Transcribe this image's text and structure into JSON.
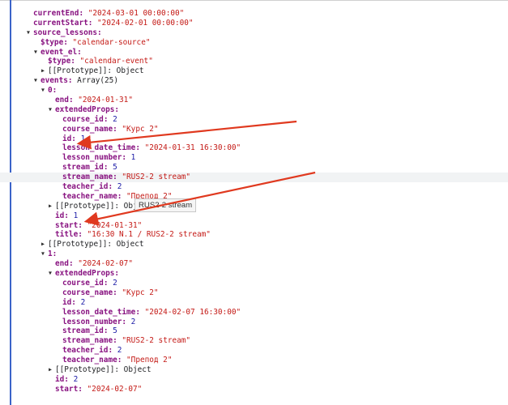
{
  "rows": [
    {
      "indent": 0,
      "key": "currentEnd",
      "sep": ": ",
      "value": "\"2024-03-01 00:00:00\"",
      "vtype": "s",
      "tri": ""
    },
    {
      "indent": 0,
      "key": "currentStart",
      "sep": ": ",
      "value": "\"2024-02-01 00:00:00\"",
      "vtype": "s",
      "tri": ""
    },
    {
      "indent": 0,
      "key": "source_lessons",
      "sep": ":",
      "value": "",
      "vtype": "s",
      "tri": "down"
    },
    {
      "indent": 1,
      "key": "$type",
      "sep": ": ",
      "value": "\"calendar-source\"",
      "vtype": "s",
      "tri": ""
    },
    {
      "indent": 1,
      "key": "event_el",
      "sep": ":",
      "value": "",
      "vtype": "s",
      "tri": "down"
    },
    {
      "indent": 2,
      "key": "$type",
      "sep": ": ",
      "value": "\"calendar-event\"",
      "vtype": "s",
      "tri": ""
    },
    {
      "indent": 2,
      "key": "[[Prototype]]",
      "sep": ": ",
      "value": "Object",
      "vtype": "p",
      "tri": "right",
      "keyPlain": true
    },
    {
      "indent": 1,
      "key": "events",
      "sep": ": ",
      "value": "Array(25)",
      "vtype": "p",
      "tri": "down"
    },
    {
      "indent": 2,
      "key": "0",
      "sep": ":",
      "value": "",
      "vtype": "s",
      "tri": "down"
    },
    {
      "indent": 3,
      "key": "end",
      "sep": ": ",
      "value": "\"2024-01-31\"",
      "vtype": "s",
      "tri": ""
    },
    {
      "indent": 3,
      "key": "extendedProps",
      "sep": ":",
      "value": "",
      "vtype": "s",
      "tri": "down"
    },
    {
      "indent": 4,
      "key": "course_id",
      "sep": ": ",
      "value": "2",
      "vtype": "n",
      "tri": ""
    },
    {
      "indent": 4,
      "key": "course_name",
      "sep": ": ",
      "value": "\"Курс 2\"",
      "vtype": "s",
      "tri": ""
    },
    {
      "indent": 4,
      "key": "id",
      "sep": ": ",
      "value": "1",
      "vtype": "n",
      "tri": ""
    },
    {
      "indent": 4,
      "key": "lesson_date_time",
      "sep": ": ",
      "value": "\"2024-01-31 16:30:00\"",
      "vtype": "s",
      "tri": ""
    },
    {
      "indent": 4,
      "key": "lesson_number",
      "sep": ": ",
      "value": "1",
      "vtype": "n",
      "tri": ""
    },
    {
      "indent": 4,
      "key": "stream_id",
      "sep": ": ",
      "value": "5",
      "vtype": "n",
      "tri": ""
    },
    {
      "indent": 4,
      "key": "stream_name",
      "sep": ": ",
      "value": "\"RUS2-2 stream\"",
      "vtype": "s",
      "tri": "",
      "hl": true
    },
    {
      "indent": 4,
      "key": "teacher_id",
      "sep": ": ",
      "value": "2",
      "vtype": "n",
      "tri": ""
    },
    {
      "indent": 4,
      "key": "teacher_name",
      "sep": ": ",
      "value": "\"Препод 2\"",
      "vtype": "s",
      "tri": ""
    },
    {
      "indent": 3,
      "key": "[[Prototype]]",
      "sep": ": ",
      "value": "Object",
      "vtype": "p",
      "tri": "right",
      "keyPlain": true
    },
    {
      "indent": 3,
      "key": "id",
      "sep": ": ",
      "value": "1",
      "vtype": "n",
      "tri": ""
    },
    {
      "indent": 3,
      "key": "start",
      "sep": ": ",
      "value": "\"2024-01-31\"",
      "vtype": "s",
      "tri": ""
    },
    {
      "indent": 3,
      "key": "title",
      "sep": ": ",
      "value": "\"16:30 N.1 / RUS2-2 stream\"",
      "vtype": "s",
      "tri": ""
    },
    {
      "indent": 2,
      "key": "[[Prototype]]",
      "sep": ": ",
      "value": "Object",
      "vtype": "p",
      "tri": "right",
      "keyPlain": true
    },
    {
      "indent": 2,
      "key": "1",
      "sep": ":",
      "value": "",
      "vtype": "s",
      "tri": "down"
    },
    {
      "indent": 3,
      "key": "end",
      "sep": ": ",
      "value": "\"2024-02-07\"",
      "vtype": "s",
      "tri": ""
    },
    {
      "indent": 3,
      "key": "extendedProps",
      "sep": ":",
      "value": "",
      "vtype": "s",
      "tri": "down"
    },
    {
      "indent": 4,
      "key": "course_id",
      "sep": ": ",
      "value": "2",
      "vtype": "n",
      "tri": ""
    },
    {
      "indent": 4,
      "key": "course_name",
      "sep": ": ",
      "value": "\"Курс 2\"",
      "vtype": "s",
      "tri": ""
    },
    {
      "indent": 4,
      "key": "id",
      "sep": ": ",
      "value": "2",
      "vtype": "n",
      "tri": ""
    },
    {
      "indent": 4,
      "key": "lesson_date_time",
      "sep": ": ",
      "value": "\"2024-02-07 16:30:00\"",
      "vtype": "s",
      "tri": ""
    },
    {
      "indent": 4,
      "key": "lesson_number",
      "sep": ": ",
      "value": "2",
      "vtype": "n",
      "tri": ""
    },
    {
      "indent": 4,
      "key": "stream_id",
      "sep": ": ",
      "value": "5",
      "vtype": "n",
      "tri": ""
    },
    {
      "indent": 4,
      "key": "stream_name",
      "sep": ": ",
      "value": "\"RUS2-2 stream\"",
      "vtype": "s",
      "tri": ""
    },
    {
      "indent": 4,
      "key": "teacher_id",
      "sep": ": ",
      "value": "2",
      "vtype": "n",
      "tri": ""
    },
    {
      "indent": 4,
      "key": "teacher_name",
      "sep": ": ",
      "value": "\"Препод 2\"",
      "vtype": "s",
      "tri": ""
    },
    {
      "indent": 3,
      "key": "[[Prototype]]",
      "sep": ": ",
      "value": "Object",
      "vtype": "p",
      "tri": "right",
      "keyPlain": true
    },
    {
      "indent": 3,
      "key": "id",
      "sep": ": ",
      "value": "2",
      "vtype": "n",
      "tri": ""
    },
    {
      "indent": 3,
      "key": "start",
      "sep": ": ",
      "value": "\"2024-02-07\"",
      "vtype": "s",
      "tri": ""
    }
  ],
  "tooltip": {
    "text": "RUS2-2 stream"
  },
  "colors": {
    "key": "#881280",
    "string": "#c41a16",
    "number": "#1a1aa6",
    "arrow": "#e0391f",
    "border": "#3b63c9"
  }
}
